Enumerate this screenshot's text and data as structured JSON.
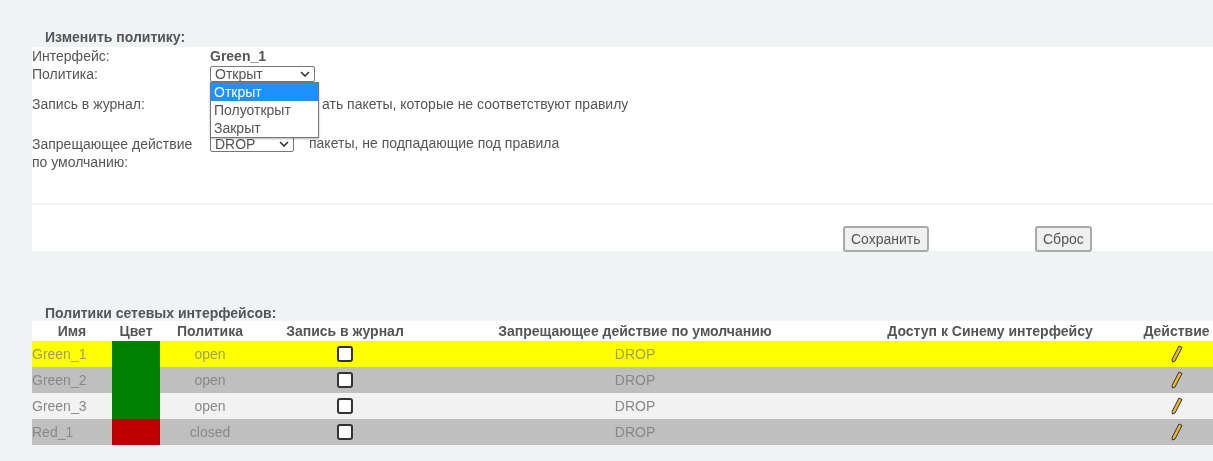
{
  "edit_policy": {
    "title": "Изменить политику:",
    "interface": {
      "label": "Интерфейс:",
      "value": "Green_1"
    },
    "policy": {
      "label": "Политика:",
      "value": "Открыт",
      "expanded": true,
      "options": [
        {
          "label": "Открыт",
          "selected": true
        },
        {
          "label": "Полуоткрыт",
          "selected": false
        },
        {
          "label": "Закрыт",
          "selected": false
        }
      ]
    },
    "log": {
      "label": "Запись в журнал:",
      "text": "ать пакеты, которые не соответствуют правилу"
    },
    "default_action": {
      "label": "Запрещающее действие по умолчанию:",
      "value": "DROP",
      "text": "пакеты, не подпадающие под правила"
    },
    "buttons": [
      "Сохранить",
      "Сброс"
    ]
  },
  "policies_table": {
    "title": "Политики сетевых интерфейсов:",
    "columns": [
      "Имя",
      "Цвет",
      "Политика",
      "Запись в журнал",
      "Запрещающее действие по умолчанию",
      "Доступ к Синему интерфейсу",
      "Действие"
    ],
    "rows": [
      {
        "name": "Green_1",
        "color": "#008000",
        "policy": "open",
        "logged": false,
        "default_action": "DROP",
        "selected": true
      },
      {
        "name": "Green_2",
        "color": "#008000",
        "policy": "open",
        "logged": false,
        "default_action": "DROP",
        "selected": false
      },
      {
        "name": "Green_3",
        "color": "#008000",
        "policy": "open",
        "logged": false,
        "default_action": "DROP",
        "selected": false
      },
      {
        "name": "Red_1",
        "color": "#c00000",
        "policy": "closed",
        "logged": false,
        "default_action": "DROP",
        "selected": false
      }
    ]
  }
}
